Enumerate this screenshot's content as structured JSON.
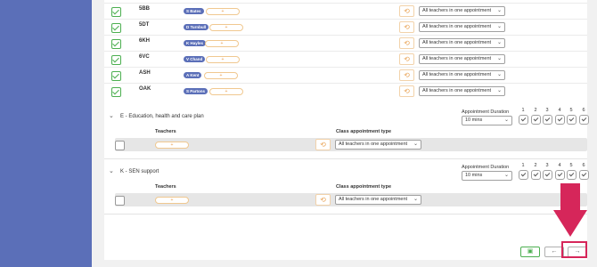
{
  "ui": {
    "add_symbol": "+",
    "reset_symbol": "⟲",
    "select_chevron": "⌄",
    "collapse_chevron": "⌄"
  },
  "class_rows": [
    {
      "code": "5BB",
      "teacher": "S Bates",
      "appointment_type": "All teachers in one appointment",
      "checked": true
    },
    {
      "code": "5DT",
      "teacher": "D Turnbull",
      "appointment_type": "All teachers in one appointment",
      "checked": true
    },
    {
      "code": "6KH",
      "teacher": "K Hayles",
      "appointment_type": "All teachers in one appointment",
      "checked": true
    },
    {
      "code": "6VC",
      "teacher": "V Chand",
      "appointment_type": "All teachers in one appointment",
      "checked": true
    },
    {
      "code": "ASH",
      "teacher": "A Kent",
      "appointment_type": "All teachers in one appointment",
      "checked": true
    },
    {
      "code": "OAK",
      "teacher": "S Partons",
      "appointment_type": "All teachers in one appointment",
      "checked": true
    }
  ],
  "sections": [
    {
      "title": "E - Education, health and care plan",
      "duration_label": "Appointment Duration",
      "duration_value": "10 mins",
      "numbers": [
        "1",
        "2",
        "3",
        "4",
        "5",
        "6"
      ],
      "teachers_header": "Teachers",
      "type_header": "Class appointment type",
      "appointment_type": "All teachers in one appointment"
    },
    {
      "title": "K - SEN support",
      "duration_label": "Appointment Duration",
      "duration_value": "10 mins",
      "numbers": [
        "1",
        "2",
        "3",
        "4",
        "5",
        "6"
      ],
      "teachers_header": "Teachers",
      "type_header": "Class appointment type",
      "appointment_type": "All teachers in one appointment"
    }
  ],
  "footer": {
    "save_icon": "▣",
    "back_icon": "←",
    "next_icon": "→"
  },
  "colors": {
    "sidebar": "#5b6fb8",
    "check": "#4caf50",
    "accent_orange": "#e8a050",
    "highlight": "#d6265a"
  }
}
